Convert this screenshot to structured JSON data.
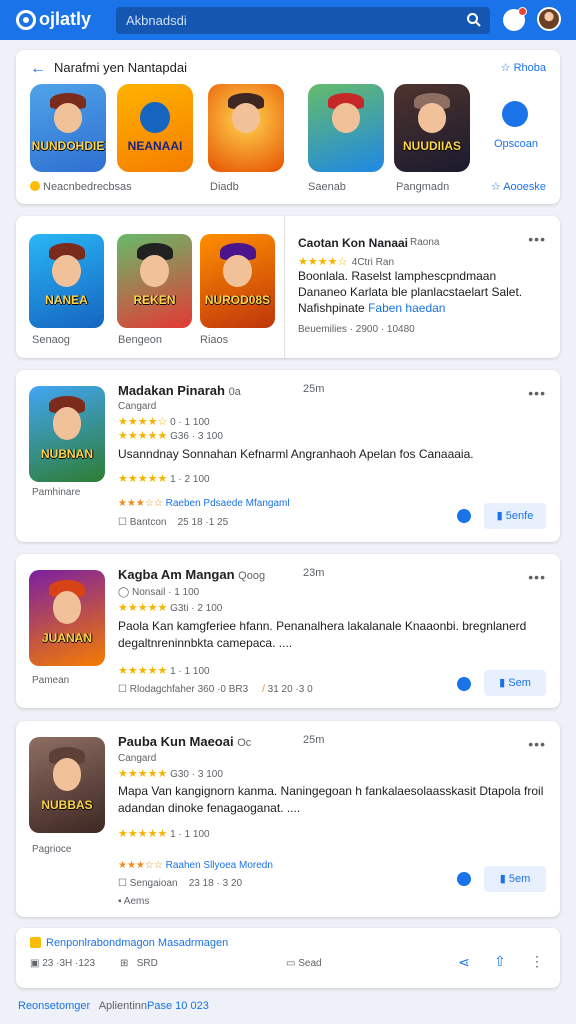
{
  "header": {
    "logo": "ojlatly",
    "search_placeholder": "Akbnadsdi"
  },
  "featured": {
    "title": "Narafmi yen Nantapdai",
    "favorite_label": "Rhoba",
    "tiles": [
      {
        "art": "NUNDOHDIE",
        "label": "Neacnbedrecbsas"
      },
      {
        "art": "NEANAAI",
        "label": ""
      },
      {
        "art": "",
        "label": "Diadb"
      },
      {
        "art": "",
        "label": "Saenab"
      },
      {
        "art": "NUUDIIAS",
        "label": "Pangmadn"
      }
    ],
    "open_label": "Opscoan",
    "add_label": "Aooeske"
  },
  "section": {
    "icons": [
      {
        "art": "NANEA",
        "label": "Senaog"
      },
      {
        "art": "REKEN",
        "label": "Bengeon"
      },
      {
        "art": "NUROD08S",
        "label": "Riaos"
      }
    ],
    "title": "Caotan Kon Nanaai",
    "subtitle": "Raona",
    "rating_count": "4Ctri Ran",
    "description": "Boonlala. Raselst lamphescpndmaan Dananeo Karlata ble planlacstaelart Salet. Nafishpinate",
    "link": "Faben haedan",
    "footer": "Beuemilies · 2900 · 10480"
  },
  "results": [
    {
      "title": "Madakan Pinarah",
      "tag": "0a",
      "time": "25m",
      "subtitle": "Cangard",
      "rating_line_1": "0 · 1 100",
      "rating_line_2": "G36 · 3 100",
      "description": "Usanndnay Sonnahan Kefnarml Angranhaoh Apelan fos Canaaaia.",
      "review_line": "1 · 2 100",
      "caption": "Pamhinare",
      "action_link": "Raeben Pdsaede Mfangaml",
      "footer_left": "Bantcon",
      "footer_mid": "25 18 ·1 25",
      "save_label": "5enfe",
      "art": "NUBNAN"
    },
    {
      "title": "Kagba Am Mangan",
      "tag": "Qoog",
      "time": "23m",
      "subtitle": "Nonsail",
      "rating_line_1": "Nonsail · 1 100",
      "rating_line_2": "G3ti · 2 100",
      "description": "Paola Kan kamgferiee hfann. Penanalhera lakalanale Knaaonbi. bregnlanerd degaltnreninnbkta camepaca. ....",
      "review_line": "1 · 1 100",
      "caption": "Pamean",
      "action_link": "",
      "footer_left": "Rlodagchfaher 360 ·0 BR3",
      "footer_mid": "31 20 ·3 0",
      "save_label": "Sem",
      "art": "JUANAN"
    },
    {
      "title": "Pauba Kun Maeoai",
      "tag": "Oc",
      "time": "25m",
      "subtitle": "Cangard",
      "rating_line_1": "",
      "rating_line_2": "G30 · 3 100",
      "description": "Mapa Van kangignorn kanma. Naningegoan h fankalaesolaasskasit Dtapola froil adandan dinoke fenagaoganat. ....",
      "review_line": "1 · 1 100",
      "caption": "Pagrioce",
      "action_link": "Raahen Sllyoea Moredn",
      "footer_left": "Sengaioan",
      "footer_mid": "23 18 · 3 20",
      "save_label": "5em",
      "extra_footer": "Aems",
      "art": "NUBBAS"
    }
  ],
  "footer_card": {
    "title": "Renponlrabondmagon Masadrmagen",
    "date": "23 ·3H ·123",
    "count": "SRD",
    "save_label": "Sead"
  },
  "bottom": {
    "text_1": "Reonsetomger",
    "text_2": "Aplientinn",
    "text_3": "Pase 10 023"
  },
  "colors": {
    "primary": "#1a73e8",
    "star": "#f4b400",
    "background": "#eef1f7"
  }
}
